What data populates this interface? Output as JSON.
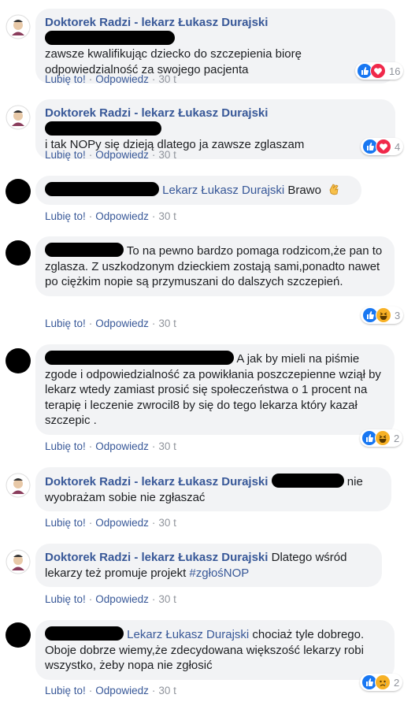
{
  "ui": {
    "like_label": "Lubię to!",
    "reply_label": "Odpowiedz",
    "dot": "·"
  },
  "comments": [
    {
      "author": "Doktorek Radzi - lekarz Łukasz Durajski",
      "text": "zawsze kwalifikując dziecko do szczepienia biorę odpowiedzialność za swojego pacjenta",
      "time": "30 t",
      "reaction_count": "16",
      "reactions": [
        "like-icon",
        "love-icon"
      ]
    },
    {
      "author": "Doktorek Radzi - lekarz Łukasz Durajski",
      "text": "i tak NOPy się dzieją dlatego ja zawsze zglaszam",
      "time": "30 t",
      "reaction_count": "4",
      "reactions": [
        "like-icon",
        "love-icon"
      ]
    },
    {
      "mention": "Lekarz Łukasz Durajski",
      "text": "Brawo",
      "time": "30 t"
    },
    {
      "text": "To na pewno bardzo pomaga rodzicom,że pan to zglasza. Z uszkodzonym dzieckiem zostają sami,ponadto nawet po ciężkim nopie są przymuszani do dalszych szczepień.",
      "time": "30 t",
      "reaction_count": "3",
      "reactions": [
        "like-icon",
        "haha-icon"
      ]
    },
    {
      "text": "A jak by mieli na piśmie zgode i odpowiedzialność za powikłania poszczepienne wziął by lekarz wtedy zamiast prosić się społeczeństwa o 1 procent na terapię i leczenie zwrocil8 by się do tego lekarza który kazał szczepic .",
      "time": "30 t",
      "reaction_count": "2",
      "reactions": [
        "like-icon",
        "haha-icon"
      ]
    },
    {
      "author": "Doktorek Radzi - lekarz Łukasz Durajski",
      "text": "nie wyobrażam sobie nie zgłaszać",
      "time": "30 t"
    },
    {
      "author": "Doktorek Radzi - lekarz Łukasz Durajski",
      "text": "Dlatego wśród lekarzy też promuje projekt",
      "hashtag": "#zgłośNOP",
      "time": "30 t"
    },
    {
      "mention": "Lekarz Łukasz Durajski",
      "text": "chociaż tyle dobrego. Oboje dobrze wiemy,że zdecydowana większość lekarzy robi wszystko, żeby nopa nie zgłosić",
      "time": "30 t",
      "reaction_count": "2",
      "reactions": [
        "like-icon",
        "sad-icon"
      ]
    }
  ]
}
